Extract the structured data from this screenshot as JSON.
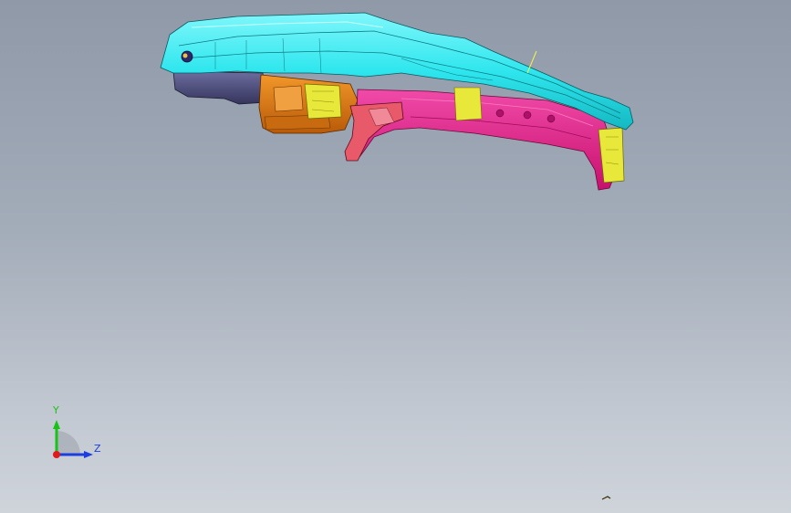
{
  "viewport": {
    "background_top": "#8f99a8",
    "background_bottom": "#cfd4db"
  },
  "model": {
    "description_colors": {
      "upper_panel": "#2fe6ee",
      "rail": "#e8158c",
      "front_block": "#e07a14",
      "rear_block": "#4a4a7a",
      "brackets": "#e8e83a",
      "lower_bracket": "#c83a52"
    }
  },
  "triad": {
    "y_label": "Y",
    "z_label": "Z",
    "y_color": "#19c219",
    "z_color": "#1a3ee0",
    "x_color": "#e01a1a"
  }
}
